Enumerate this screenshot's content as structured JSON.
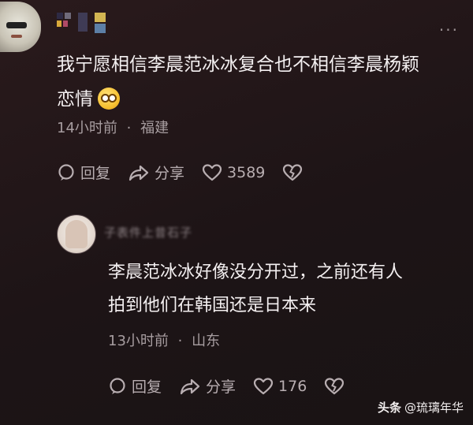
{
  "comment": {
    "name_placeholder": "",
    "content_line1": "我宁愿相信李晨范冰冰复合也不相信李晨杨颖",
    "content_line2": "恋情",
    "emoji": "flushed-face",
    "time": "14小时前",
    "separator": "·",
    "location": "福建",
    "reply_label": "回复",
    "share_label": "分享",
    "like_count": "3589"
  },
  "reply": {
    "name_blurred": "子表件上昔石子",
    "content_line1": "李晨范冰冰好像没分开过，之前还有人",
    "content_line2": "拍到他们在韩国还是日本来",
    "time": "13小时前",
    "separator": "·",
    "location": "山东",
    "reply_label": "回复",
    "share_label": "分享",
    "like_count": "176"
  },
  "watermark": {
    "brand": "头条",
    "handle": "@琉璃年华"
  },
  "colors": {
    "background": "#1d1416",
    "text_primary": "#f4f0f1",
    "text_secondary": "#a79da0"
  }
}
